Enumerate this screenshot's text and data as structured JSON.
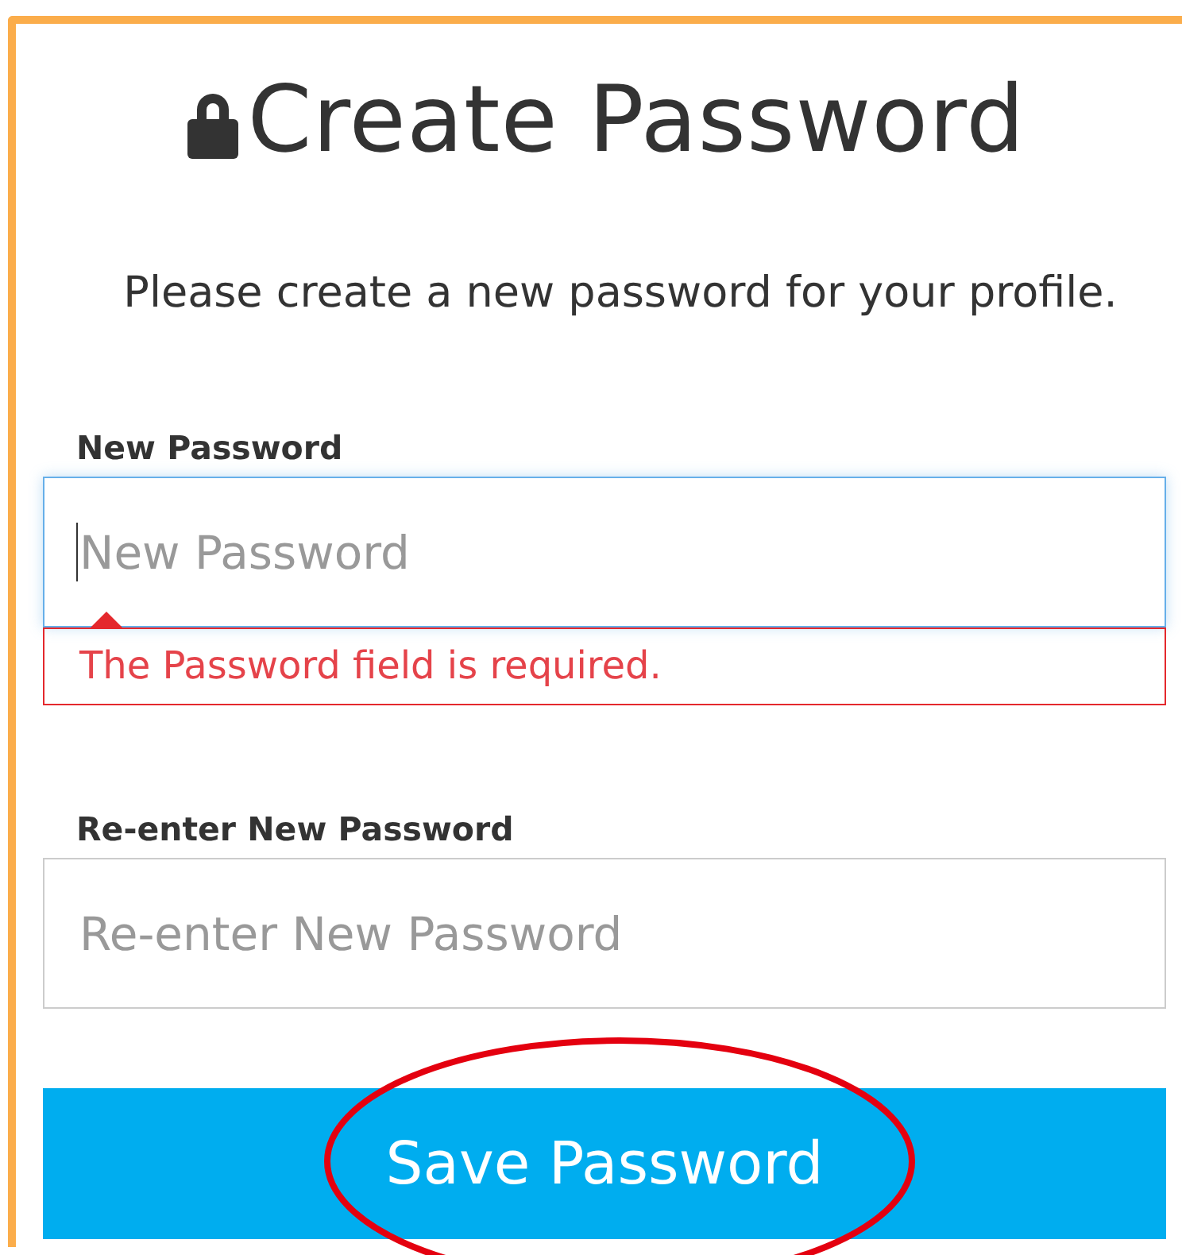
{
  "title": "Create Password",
  "intro": "Please create a new password for your profile.",
  "fields": [
    {
      "label": "New Password",
      "placeholder": "New Password",
      "focused": true,
      "error": "The Password field is required."
    },
    {
      "label": "Re-enter New Password",
      "placeholder": "Re-enter New Password",
      "focused": false
    }
  ],
  "button": {
    "label": "Save Password",
    "circled": true
  }
}
